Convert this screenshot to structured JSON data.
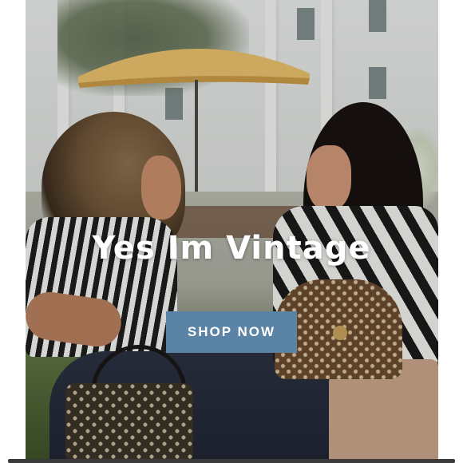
{
  "hero": {
    "headline": "Yes Im Vintage",
    "cta_label": "SHOP NOW",
    "image_subject": "two-women-with-vintage-monogram-handbags"
  },
  "colors": {
    "cta_background": "#5b83a6",
    "headline_text": "#ffffff",
    "page_background": "#ffffff"
  }
}
